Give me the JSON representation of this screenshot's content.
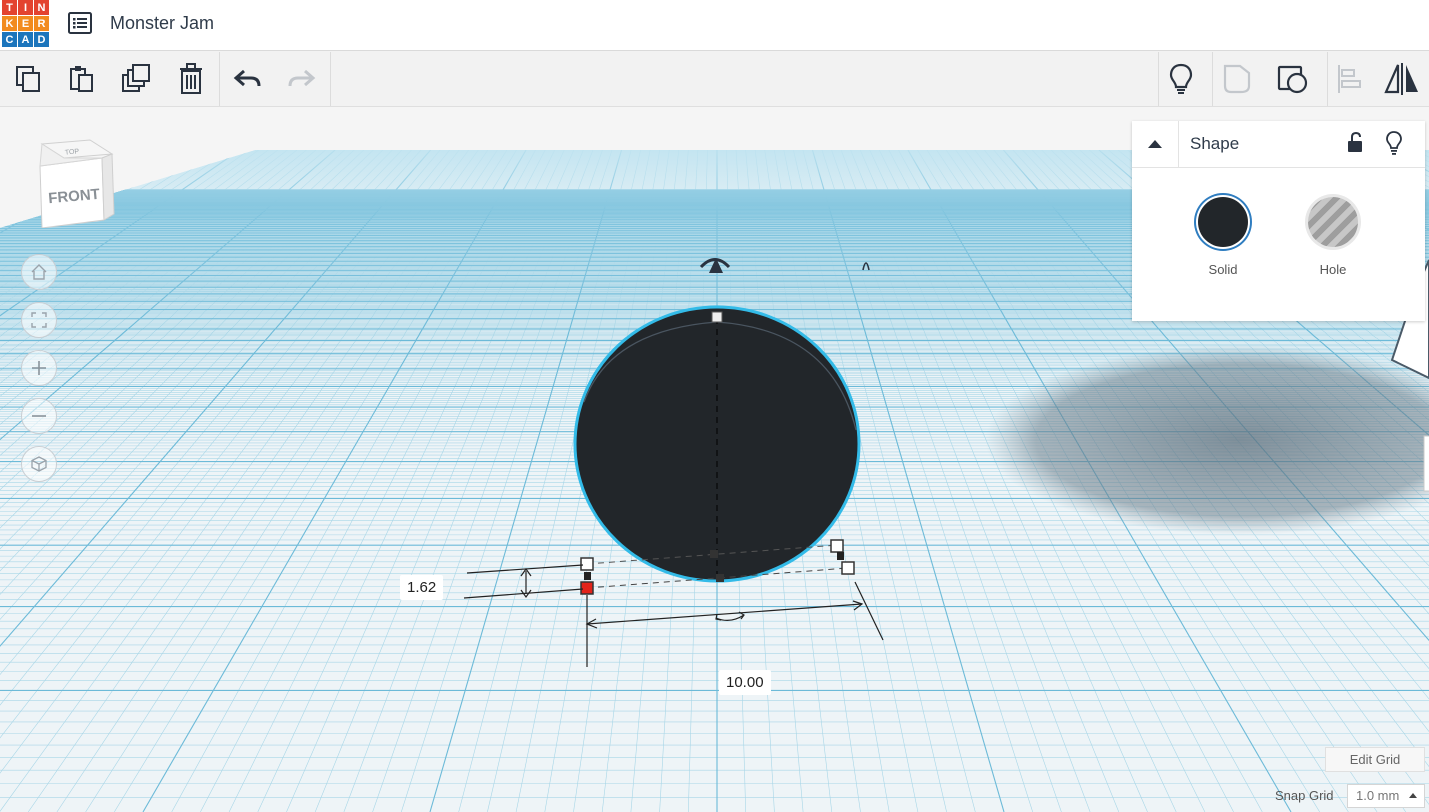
{
  "app": {
    "logo_letters": [
      "T",
      "I",
      "N",
      "K",
      "E",
      "R",
      "C",
      "A",
      "D"
    ],
    "logo_colors": [
      "#e3432f",
      "#e3432f",
      "#e3432f",
      "#f28b1e",
      "#f28b1e",
      "#f28b1e",
      "#1c75bc",
      "#1c75bc",
      "#1c75bc"
    ],
    "document_title": "Monster Jam"
  },
  "toolbar": {
    "left_icons": [
      "copy-icon",
      "paste-icon",
      "duplicate-icon",
      "delete-icon",
      "undo-icon",
      "redo-icon"
    ],
    "right_icons": [
      "notes-bulb-icon",
      "show-all-icon",
      "group-icon",
      "align-icon",
      "mirror-icon"
    ],
    "redo_enabled": false
  },
  "viewcube": {
    "top_label": "TOP",
    "front_label": "FRONT"
  },
  "nav_controls": [
    "home-view-icon",
    "fit-all-icon",
    "zoom-in-icon",
    "zoom-out-icon",
    "perspective-icon"
  ],
  "inspector": {
    "title": "Shape",
    "modes": [
      {
        "label": "Solid",
        "selected": true,
        "color": "#22262a"
      },
      {
        "label": "Hole",
        "selected": false,
        "color": "#b5b5b5"
      }
    ]
  },
  "dimensions": {
    "height": "1.62",
    "width": "10.00"
  },
  "colors": {
    "accent_outline": "#33bbe8",
    "shape_fill": "#22262a",
    "grid_line": "#9fd3e6",
    "grid_major": "#6ab8d6",
    "active_handle": "#e2231a"
  },
  "grid": {
    "edit_label": "Edit Grid",
    "snap_label": "Snap Grid",
    "snap_value": "1.0 mm"
  }
}
